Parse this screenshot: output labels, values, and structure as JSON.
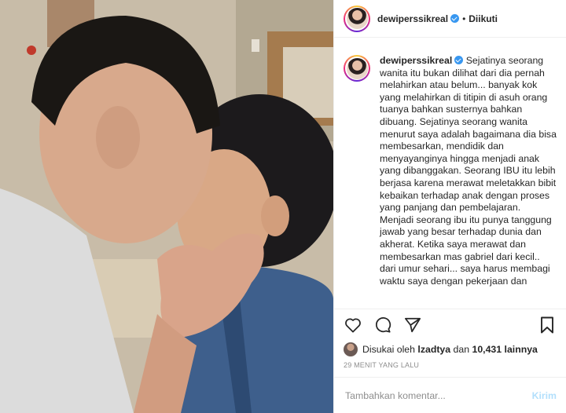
{
  "header": {
    "username": "dewiperssikreal",
    "follow_status": "Diikuti"
  },
  "caption": {
    "username": "dewiperssikreal",
    "text": "Sejatinya seorang wanita itu bukan dilihat dari dia pernah melahirkan atau belum... banyak kok yang melahirkan di titipin di asuh orang tuanya bahkan susternya bahkan dibuang. Sejatinya seorang wanita menurut saya adalah bagaimana dia bisa membesarkan, mendidik dan menyayanginya hingga menjadi anak yang dibanggakan. Seorang IBU itu lebih berjasa karena merawat meletakkan bibit kebaikan terhadap anak dengan proses yang panjang dan pembelajaran. Menjadi seorang ibu itu punya tanggung jawab yang besar terhadap dunia dan akherat. Ketika saya merawat dan membesarkan mas gabriel dari kecil.. dari umur sehari... saya harus membagi waktu saya dengan pekerjaan dan"
  },
  "actions": {
    "like_icon": "heart-icon",
    "comment_icon": "comment-icon",
    "share_icon": "share-icon",
    "save_icon": "bookmark-icon"
  },
  "likes": {
    "prefix": "Disukai oleh",
    "liker": "lzadtya",
    "middle": "dan",
    "count": "10,431 lainnya"
  },
  "timestamp": "29 MENIT YANG LALU",
  "comment_input": {
    "placeholder": "Tambahkan komentar...",
    "post_label": "Kirim"
  },
  "colors": {
    "verified": "#3897f0",
    "post_button_disabled": "#b2dffc",
    "muted_text": "#8e8e8e"
  }
}
